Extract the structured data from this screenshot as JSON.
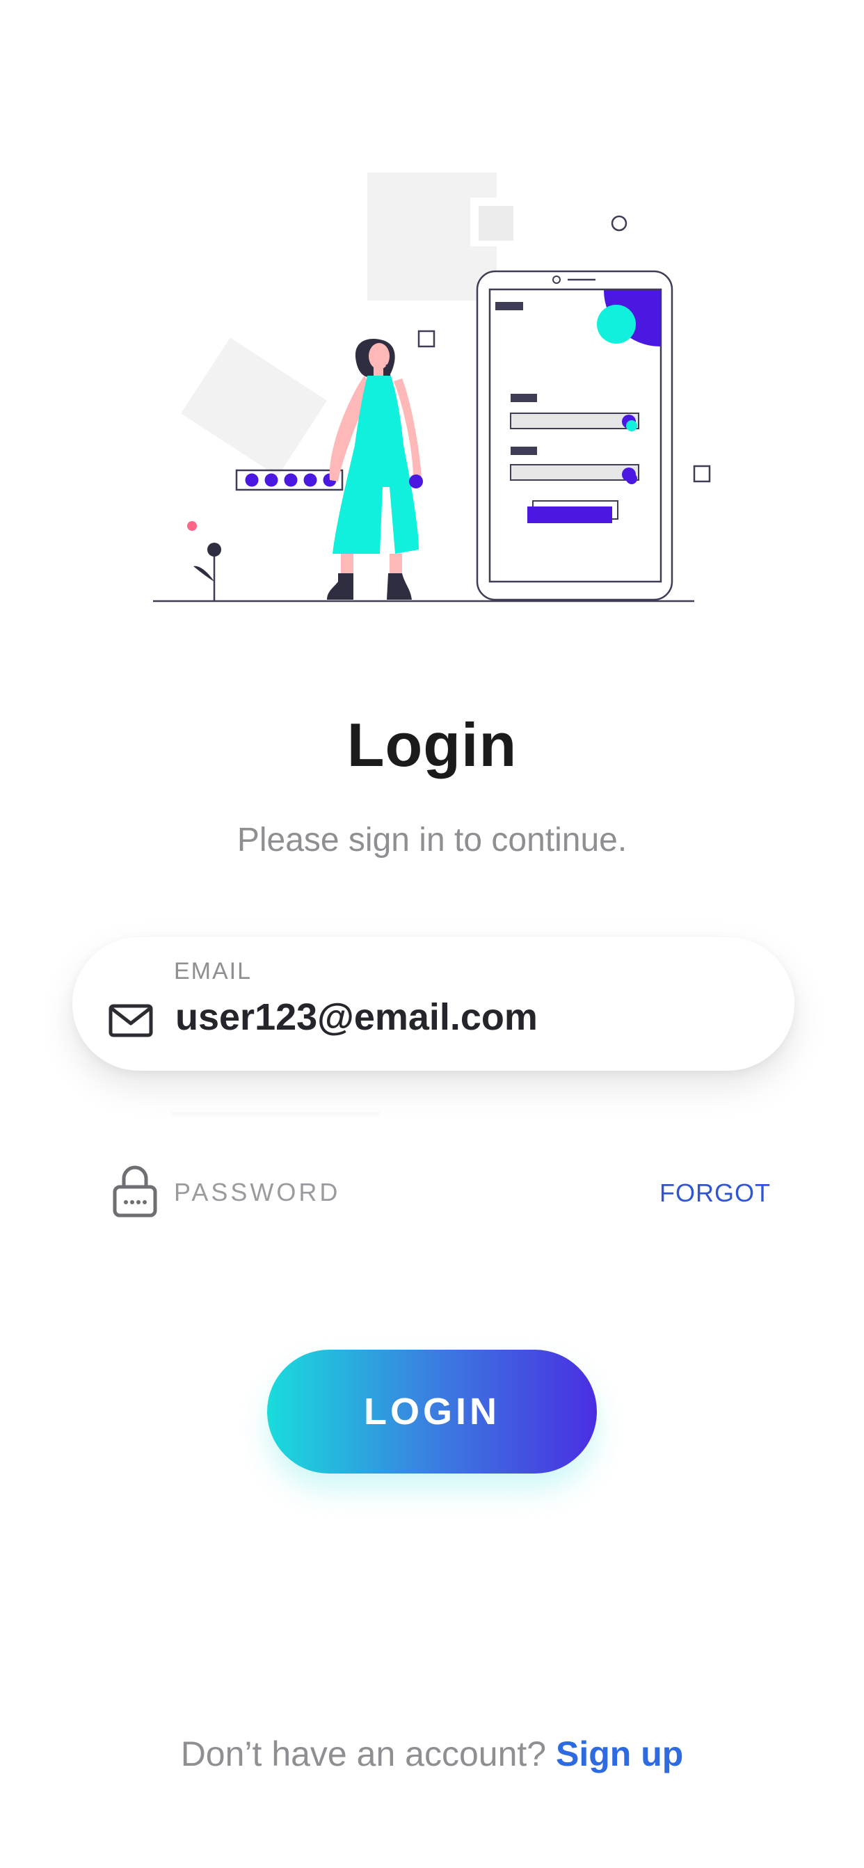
{
  "header": {
    "title": "Login",
    "subtitle": "Please sign in to continue."
  },
  "email_field": {
    "label": "EMAIL",
    "value": "user123@email.com",
    "icon": "mail-icon"
  },
  "password_field": {
    "placeholder": "PASSWORD",
    "icon": "lock-icon",
    "forgot_label": "FORGOT"
  },
  "login_button": {
    "label": "LOGIN"
  },
  "footer": {
    "prompt": "Don’t have an account?",
    "link_label": "Sign up"
  },
  "colors": {
    "accent_blue": "#2f55d4",
    "teal": "#19dcdc",
    "purple": "#4a2ee2",
    "illustration_teal": "#11f0dc",
    "illustration_purple": "#4a18e0"
  }
}
